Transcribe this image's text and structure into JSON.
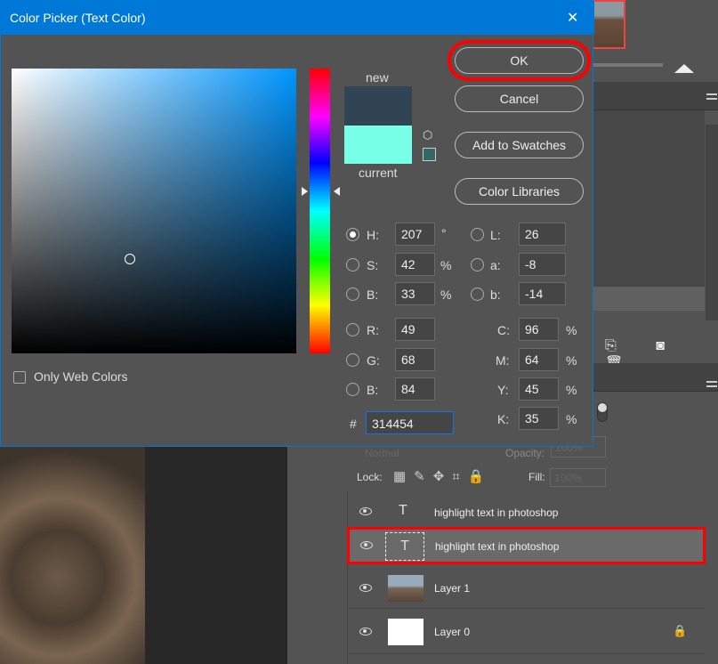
{
  "dialog": {
    "title": "Color Picker (Text Color)",
    "close": "✕",
    "new_label": "new",
    "current_label": "current",
    "new_color": "#314454",
    "current_color": "#77ffe8",
    "buttons": {
      "ok": "OK",
      "cancel": "Cancel",
      "add_swatches": "Add to Swatches",
      "libraries": "Color Libraries"
    },
    "only_web": "Only Web Colors",
    "hsb": [
      {
        "label": "H:",
        "value": "207",
        "unit": "°",
        "selected": true
      },
      {
        "label": "S:",
        "value": "42",
        "unit": "%"
      },
      {
        "label": "B:",
        "value": "33",
        "unit": "%"
      }
    ],
    "lab": [
      {
        "label": "L:",
        "value": "26"
      },
      {
        "label": "a:",
        "value": "-8"
      },
      {
        "label": "b:",
        "value": "-14"
      }
    ],
    "rgb": [
      {
        "label": "R:",
        "value": "49"
      },
      {
        "label": "G:",
        "value": "68"
      },
      {
        "label": "B:",
        "value": "84"
      }
    ],
    "cmyk": [
      {
        "label": "C:",
        "value": "96",
        "unit": "%"
      },
      {
        "label": "M:",
        "value": "64",
        "unit": "%"
      },
      {
        "label": "Y:",
        "value": "45",
        "unit": "%"
      },
      {
        "label": "K:",
        "value": "35",
        "unit": "%"
      }
    ],
    "hex_label": "#",
    "hex": "314454"
  },
  "layers_panel": {
    "blend": "Normal",
    "opacity_label": "Opacity:",
    "opacity": "100%",
    "lock_label": "Lock:",
    "fill_label": "Fill:",
    "fill": "100%",
    "layers": [
      {
        "name": "highlight text in photoshop",
        "type": "text"
      },
      {
        "name": "highlight text in photoshop",
        "type": "text",
        "selected": true
      },
      {
        "name": "Layer 1",
        "type": "smart"
      },
      {
        "name": "Layer 0",
        "type": "white",
        "locked": true
      }
    ]
  },
  "highlight_color": "#ff0000"
}
